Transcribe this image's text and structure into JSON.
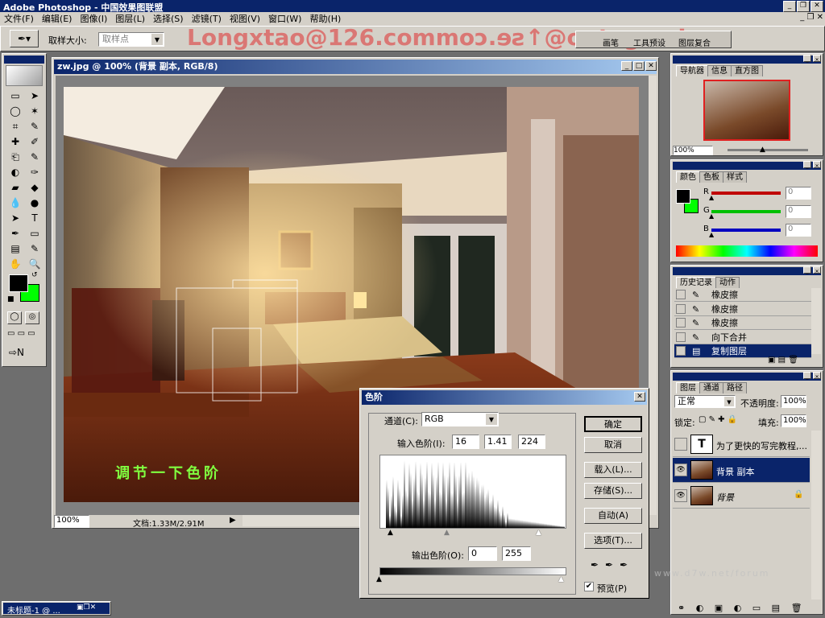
{
  "app": {
    "title": "Adobe Photoshop - 中国效果图联盟",
    "watermark": "Longxtao@126.commoɔ.ɘƨ↑@oɒtxgno⅃"
  },
  "menu": [
    "文件(F)",
    "编辑(E)",
    "图像(I)",
    "图层(L)",
    "选择(S)",
    "滤镜(T)",
    "视图(V)",
    "窗口(W)",
    "帮助(H)"
  ],
  "options": {
    "sample_label": "取样大小:",
    "sample_value": "取样点",
    "tabs": [
      "画笔",
      "工具预设",
      "图层复合"
    ]
  },
  "doc": {
    "title": "zw.jpg @ 100% (背景 副本, RGB/8)",
    "zoom": "100%",
    "status": "文档:1.33M/2.91M",
    "overlay_text": "调节一下色阶"
  },
  "navigator": {
    "tabs": [
      "导航器",
      "信息",
      "直方图"
    ],
    "zoom": "100%"
  },
  "color": {
    "tabs": [
      "颜色",
      "色板",
      "样式"
    ],
    "channels": [
      {
        "label": "R",
        "value": "0",
        "color": "#c00000"
      },
      {
        "label": "G",
        "value": "0",
        "color": "#00c000"
      },
      {
        "label": "B",
        "value": "0",
        "color": "#0000c0"
      }
    ]
  },
  "history": {
    "tabs": [
      "历史记录",
      "动作"
    ],
    "items": [
      "橡皮擦",
      "橡皮擦",
      "橡皮擦",
      "向下合并",
      "复制图层"
    ]
  },
  "layers": {
    "tabs": [
      "图层",
      "通道",
      "路径"
    ],
    "blend": "正常",
    "opacity_label": "不透明度:",
    "opacity": "100%",
    "lock_label": "锁定:",
    "fill_label": "填充:",
    "fill": "100%",
    "items": [
      {
        "name": "为了更快的写完教程,...",
        "thumb": "T"
      },
      {
        "name": "背景 副本",
        "thumb": ""
      },
      {
        "name": "背景",
        "thumb": ""
      }
    ]
  },
  "levels": {
    "title": "色阶",
    "channel_label": "通道(C):",
    "channel": "RGB",
    "input_label": "输入色阶(I):",
    "in_black": "16",
    "in_gamma": "1.41",
    "in_white": "224",
    "output_label": "输出色阶(O):",
    "out_black": "0",
    "out_white": "255",
    "buttons": [
      "确定",
      "取消",
      "载入(L)...",
      "存储(S)...",
      "自动(A)",
      "选项(T)..."
    ],
    "preview": "预览(P)"
  },
  "taskbar": {
    "minimized": "未标题-1 @ ..."
  },
  "site_watermark": "www.d7w.net/forum",
  "tools": [
    "▭",
    "➤",
    "◯",
    "✶",
    "⌗",
    "✎",
    "✚",
    "✐",
    "⎗",
    "✎",
    "◐",
    "✑",
    "▰",
    "◆",
    "💧",
    "●",
    "➤",
    "T",
    "✒",
    "▭",
    "▤",
    "✎",
    "✋",
    "🔍"
  ]
}
